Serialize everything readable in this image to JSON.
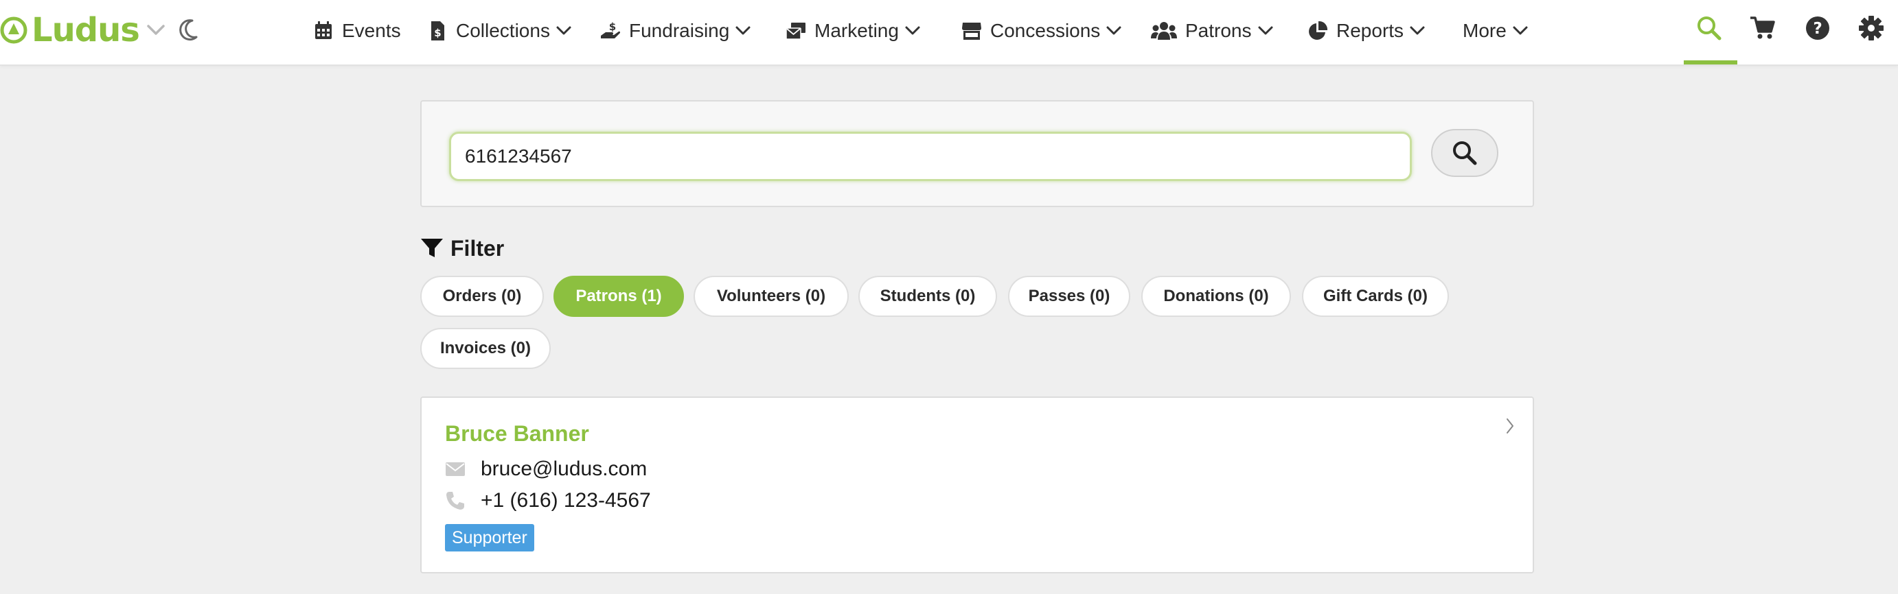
{
  "app": {
    "logo_text": "Ludus",
    "brand_color": "#8cc040"
  },
  "nav": {
    "items": [
      {
        "label": "Events",
        "icon": "calendar-icon"
      },
      {
        "label": "Collections",
        "icon": "document-dollar-icon"
      },
      {
        "label": "Fundraising",
        "icon": "hand-dollar-icon"
      },
      {
        "label": "Marketing",
        "icon": "envelope-stack-icon"
      },
      {
        "label": "Concessions",
        "icon": "store-icon"
      },
      {
        "label": "Patrons",
        "icon": "users-icon"
      },
      {
        "label": "Reports",
        "icon": "pie-chart-icon"
      },
      {
        "label": "More",
        "icon": "chevron-down-icon"
      }
    ],
    "utility_icons": [
      "search-icon",
      "cart-icon",
      "help-icon",
      "gear-icon"
    ],
    "active_utility": "search-icon"
  },
  "search": {
    "value": "6161234567"
  },
  "filter": {
    "heading": "Filter",
    "pills": [
      {
        "label": "Orders (0)",
        "active": false
      },
      {
        "label": "Patrons (1)",
        "active": true
      },
      {
        "label": "Volunteers (0)",
        "active": false
      },
      {
        "label": "Students (0)",
        "active": false
      },
      {
        "label": "Passes (0)",
        "active": false
      },
      {
        "label": "Donations (0)",
        "active": false
      },
      {
        "label": "Gift Cards (0)",
        "active": false
      },
      {
        "label": "Invoices (0)",
        "active": false
      }
    ]
  },
  "results": [
    {
      "name": "Bruce Banner",
      "email": "bruce@ludus.com",
      "phone": "+1 (616) 123-4567",
      "tag": "Supporter",
      "tag_color": "#4a9fe0"
    }
  ]
}
